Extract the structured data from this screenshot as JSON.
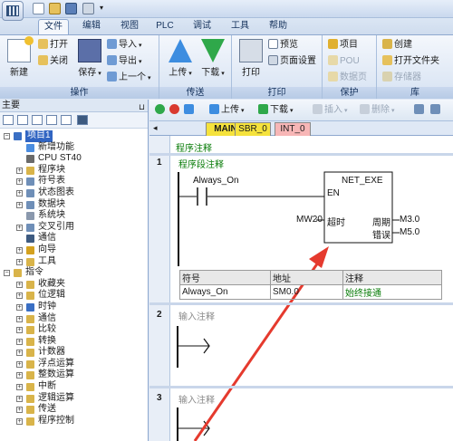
{
  "tabs": [
    {
      "label": "文件",
      "active": true
    },
    {
      "label": "编辑"
    },
    {
      "label": "视图"
    },
    {
      "label": "PLC"
    },
    {
      "label": "调试"
    },
    {
      "label": "工具"
    },
    {
      "label": "帮助"
    }
  ],
  "ribbon": {
    "groups": {
      "operation": "操作",
      "transfer": "传送",
      "print": "打印",
      "protect": "保护",
      "library": "库"
    },
    "new": "新建",
    "open": "打开",
    "close": "关闭",
    "save": "保存",
    "import": "导入",
    "export": "导出",
    "previous": "上一个",
    "upload": "上传",
    "download": "下载",
    "print": "打印",
    "preview": "预览",
    "page_setup": "页面设置",
    "project": "项目",
    "pou": "POU",
    "data_page": "数据页",
    "create": "创建",
    "open_folder": "打开文件夹",
    "memory": "存储器"
  },
  "left_panel": {
    "title": "主要",
    "pin": "⊔",
    "tree": [
      {
        "label": "项目1",
        "level": 0,
        "exp": "−",
        "selected": true,
        "icon": "project-icon",
        "color": "#3a6fc4"
      },
      {
        "label": "新增功能",
        "level": 1,
        "icon": "new-feature-icon",
        "color": "#4b8de0"
      },
      {
        "label": "CPU ST40",
        "level": 1,
        "icon": "cpu-icon",
        "color": "#6a6a6a"
      },
      {
        "label": "程序块",
        "level": 1,
        "exp": "+",
        "icon": "folder-icon",
        "color": "#d9b44a"
      },
      {
        "label": "符号表",
        "level": 1,
        "exp": "+",
        "icon": "table-icon",
        "color": "#6f8fb8"
      },
      {
        "label": "状态图表",
        "level": 1,
        "exp": "+",
        "icon": "status-chart-icon",
        "color": "#6f8fb8"
      },
      {
        "label": "数据块",
        "level": 1,
        "exp": "+",
        "icon": "data-block-icon",
        "color": "#6f8fb8"
      },
      {
        "label": "系统块",
        "level": 1,
        "icon": "system-block-icon",
        "color": "#8a98ad"
      },
      {
        "label": "交叉引用",
        "level": 1,
        "exp": "+",
        "icon": "cross-ref-icon",
        "color": "#6f8fb8"
      },
      {
        "label": "通信",
        "level": 1,
        "icon": "comm-icon",
        "color": "#3d5a80"
      },
      {
        "label": "向导",
        "level": 1,
        "exp": "+",
        "icon": "wizard-icon",
        "color": "#d4a11f"
      },
      {
        "label": "工具",
        "level": 1,
        "exp": "+",
        "icon": "tools-icon",
        "color": "#d9b44a"
      },
      {
        "label": "指令",
        "level": 0,
        "exp": "−",
        "icon": "instructions-icon",
        "color": "#d9b44a"
      },
      {
        "label": "收藏夹",
        "level": 1,
        "exp": "+",
        "icon": "favorites-icon",
        "color": "#d9b44a"
      },
      {
        "label": "位逻辑",
        "level": 1,
        "exp": "+",
        "icon": "bit-logic-icon",
        "color": "#d9b44a"
      },
      {
        "label": "时钟",
        "level": 1,
        "exp": "+",
        "icon": "clock-icon",
        "color": "#3a6fc4"
      },
      {
        "label": "通信",
        "level": 1,
        "exp": "+",
        "icon": "comm-instr-icon",
        "color": "#d9b44a"
      },
      {
        "label": "比较",
        "level": 1,
        "exp": "+",
        "icon": "compare-icon",
        "color": "#d9b44a"
      },
      {
        "label": "转换",
        "level": 1,
        "exp": "+",
        "icon": "convert-icon",
        "color": "#d9b44a"
      },
      {
        "label": "计数器",
        "level": 1,
        "exp": "+",
        "icon": "counter-icon",
        "color": "#d9b44a"
      },
      {
        "label": "浮点运算",
        "level": 1,
        "exp": "+",
        "icon": "float-icon",
        "color": "#d9b44a"
      },
      {
        "label": "整数运算",
        "level": 1,
        "exp": "+",
        "icon": "integer-icon",
        "color": "#d9b44a"
      },
      {
        "label": "中断",
        "level": 1,
        "exp": "+",
        "icon": "interrupt-icon",
        "color": "#d9b44a"
      },
      {
        "label": "逻辑运算",
        "level": 1,
        "exp": "+",
        "icon": "logic-op-icon",
        "color": "#d9b44a"
      },
      {
        "label": "传送",
        "level": 1,
        "exp": "+",
        "icon": "move-icon",
        "color": "#d9b44a"
      },
      {
        "label": "程序控制",
        "level": 1,
        "exp": "+",
        "icon": "program-control-icon",
        "color": "#d9b44a"
      }
    ]
  },
  "editor": {
    "toolbar": {
      "upload": "上传",
      "download": "下载",
      "insert": "插入",
      "delete": "删除"
    },
    "tabs": [
      {
        "label": "MAIN",
        "color": "#f5e23c"
      },
      {
        "label": "SBR_0",
        "color": "#f5e23c"
      },
      {
        "label": "INT_0",
        "color": "#f7b6b6"
      }
    ],
    "program_comment": "程序注释",
    "networks": [
      {
        "number": "1",
        "comment": "程序段注释"
      },
      {
        "number": "2",
        "comment": "输入注释"
      },
      {
        "number": "3",
        "comment": "输入注释"
      }
    ],
    "contact": "Always_On",
    "box": {
      "title": "NET_EXE",
      "en": "EN",
      "timeout_label": "超时",
      "timeout_value": "MW20",
      "cycle_label": "周期",
      "cycle_value": "M3.0",
      "error_label": "错误",
      "error_value": "M5.0"
    },
    "symbol_table": {
      "headers": [
        "符号",
        "地址",
        "注释"
      ],
      "rows": [
        [
          "Always_On",
          "SM0.0",
          "始终接通"
        ]
      ]
    }
  }
}
